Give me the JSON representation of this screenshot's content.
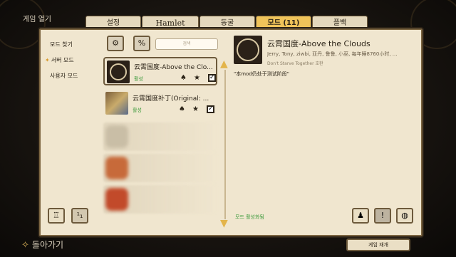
{
  "window_title": "게임 열기",
  "tabs": [
    {
      "label": "설정"
    },
    {
      "label": "Hamlet"
    },
    {
      "label": "동굴"
    },
    {
      "label": "모드 (11)"
    },
    {
      "label": "플백"
    }
  ],
  "nav": {
    "items": [
      {
        "label": "모드 찾기"
      },
      {
        "label": "서버 모드"
      },
      {
        "label": "사용자 모드"
      }
    ]
  },
  "search": {
    "placeholder": "검색"
  },
  "mods": [
    {
      "name": "云霄国度-Above the Clo...",
      "status": "활성"
    },
    {
      "name": "云霄国度补丁(Original: ...",
      "status": "활성"
    }
  ],
  "detail": {
    "title": "云霄国度-Above the Clouds",
    "authors": "Jerry, Tony, ziwbi, 亚丹, 鲁鲁, 小巫, 每年睡8760小时, ...",
    "tag": "Don't Starve Together 호환",
    "description": "\"本mod仍处于测试阶段\""
  },
  "status_text": "모드 활성화됨",
  "bottom": {
    "back_label": "돌아가기",
    "resume_label": "게임 재개"
  },
  "colors": {
    "accent": "#f0c45a",
    "panel": "#f0e6cf",
    "enabled": "#3a9a3a"
  }
}
